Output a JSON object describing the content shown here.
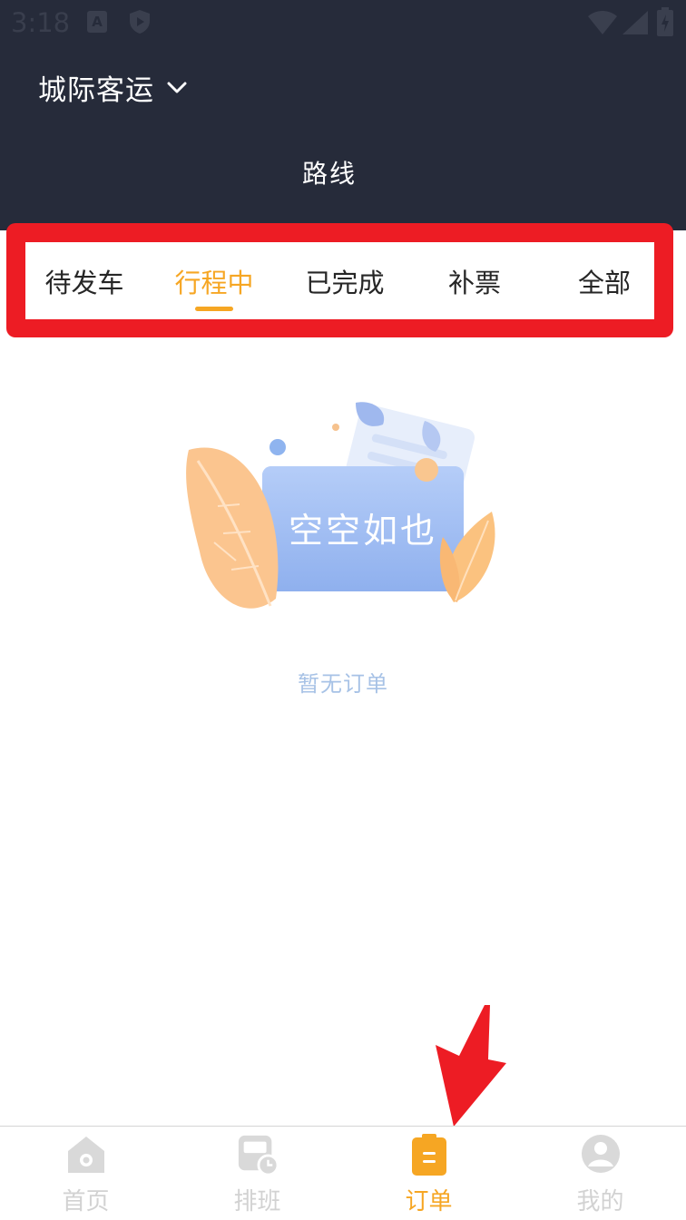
{
  "status_bar": {
    "time": "3:18",
    "a_badge": "A",
    "icons": [
      "a-badge-icon",
      "shield-icon",
      "wifi-icon",
      "signal-icon",
      "battery-icon"
    ]
  },
  "header": {
    "city_selector": "城际客运",
    "city_icon": "chevron-down-icon",
    "title": "路线",
    "bg_color": "#262b3a"
  },
  "tabs": {
    "items": [
      {
        "label": "待发车",
        "active": false
      },
      {
        "label": "行程中",
        "active": true
      },
      {
        "label": "已完成",
        "active": false
      },
      {
        "label": "补票",
        "active": false
      },
      {
        "label": "全部",
        "active": false
      }
    ],
    "active_color": "#f6a623",
    "highlight_color": "#ed1c24"
  },
  "empty": {
    "illustration_text": "空空如也",
    "message": "暂无订单"
  },
  "bottom_nav": {
    "items": [
      {
        "label": "首页",
        "icon": "home-icon",
        "active": false
      },
      {
        "label": "排班",
        "icon": "bus-schedule-icon",
        "active": false
      },
      {
        "label": "订单",
        "icon": "order-clipboard-icon",
        "active": true
      },
      {
        "label": "我的",
        "icon": "profile-icon",
        "active": false
      }
    ]
  },
  "annotation": {
    "icon": "red-arrow-icon",
    "color": "#ed1c24"
  }
}
